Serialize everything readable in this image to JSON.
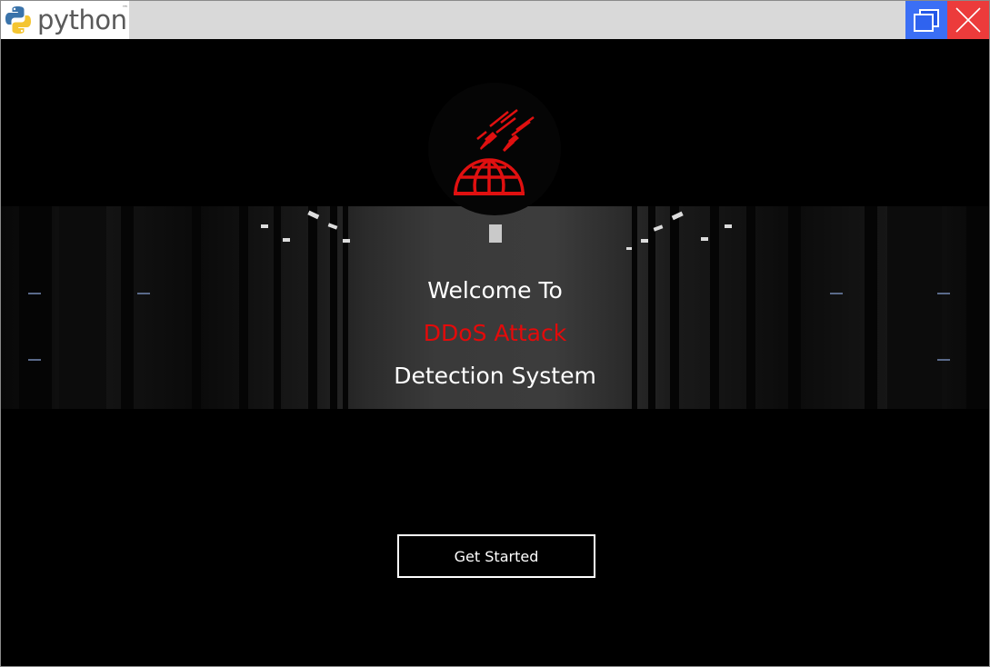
{
  "window": {
    "app_logo_text": "python",
    "trademark": "™",
    "controls": [
      "maximize",
      "close"
    ]
  },
  "icons": {
    "python_logo": "python-logo-icon",
    "maximize": "maximize-icon",
    "close": "close-icon",
    "emblem": "ddos-attack-globe-icon"
  },
  "welcome": {
    "line1": "Welcome To",
    "line2": "DDoS Attack",
    "line3": "Detection System"
  },
  "actions": {
    "get_started_label": "Get Started"
  },
  "colors": {
    "accent_red": "#e40a0a",
    "maximize_bg": "#3b6ff5",
    "close_bg": "#ec3b3b",
    "titlebar_bg": "#d9d9d9",
    "page_bg": "#000000"
  }
}
